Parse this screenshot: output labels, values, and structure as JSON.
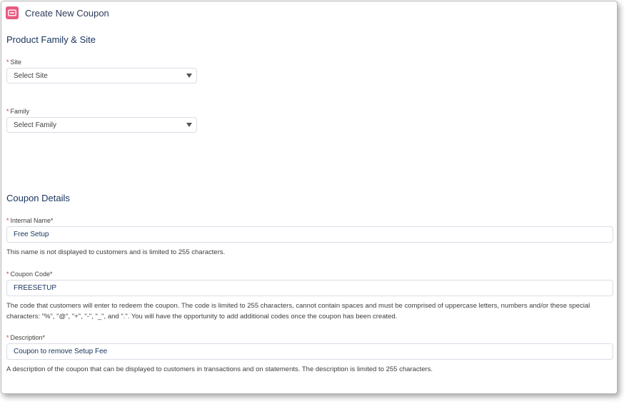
{
  "header": {
    "title": "Create New Coupon",
    "icon": "coupon-icon",
    "icon_color": "#e85a7f"
  },
  "product_family_site": {
    "title": "Product Family & Site",
    "site": {
      "label": "Site",
      "required_mark": "*",
      "selected": "Select Site"
    },
    "family": {
      "label": "Family",
      "required_mark": "*",
      "selected": "Select Family"
    }
  },
  "coupon_details": {
    "title": "Coupon Details",
    "internal_name": {
      "label": "Internal Name*",
      "required_mark": "*",
      "value": "Free Setup",
      "help": "This name is not displayed to customers and is limited to 255 characters."
    },
    "coupon_code": {
      "label": "Coupon Code*",
      "required_mark": "*",
      "value": "FREESETUP",
      "help": "The code that customers will enter to redeem the coupon. The code is limited to 255 characters, cannot contain spaces and must be comprised of uppercase letters, numbers and/or these special characters: \"%\", \"@\", \"+\", \"-\", \"_\", and \".\". You will have the opportunity to add additional codes once the coupon has been created."
    },
    "description": {
      "label": "Description*",
      "required_mark": "*",
      "value": "Coupon to remove Setup Fee",
      "help": "A description of the coupon that can be displayed to customers in transactions and on statements. The description is limited to 255 characters."
    }
  },
  "colors": {
    "required": "#c23934",
    "section_title": "#16325c",
    "input_border": "#d8dde6"
  }
}
